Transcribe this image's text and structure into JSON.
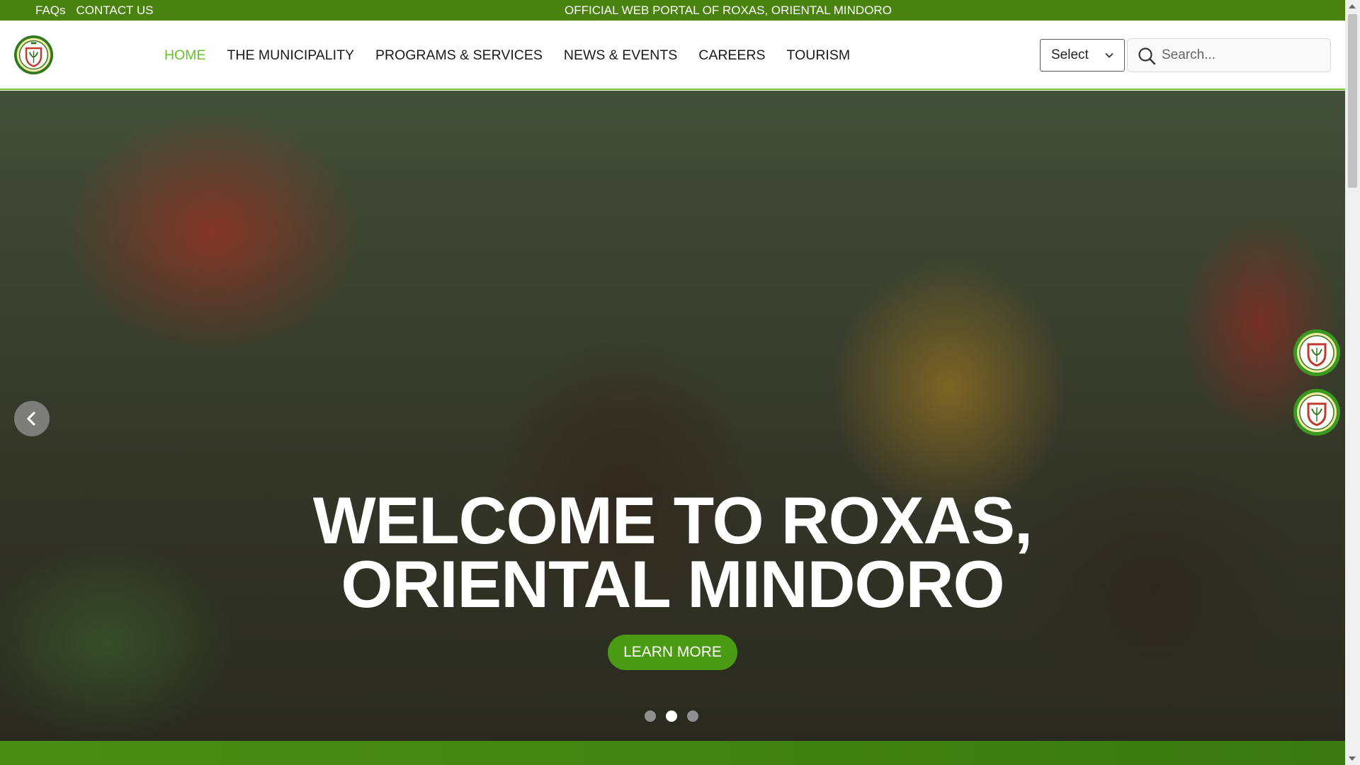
{
  "topbar": {
    "links": [
      "FAQs",
      "CONTACT US"
    ],
    "portal_title": "OFFICIAL WEB PORTAL OF ROXAS, ORIENTAL MINDORO"
  },
  "header": {
    "logo_icon": "municipal-seal-icon",
    "nav": [
      {
        "label": "HOME",
        "active": true
      },
      {
        "label": "THE MUNICIPALITY",
        "active": false
      },
      {
        "label": "PROGRAMS & SERVICES",
        "active": false
      },
      {
        "label": "NEWS & EVENTS",
        "active": false
      },
      {
        "label": "CAREERS",
        "active": false
      },
      {
        "label": "TOURISM",
        "active": false
      }
    ],
    "language_select": {
      "selected": "Select"
    },
    "search": {
      "placeholder": "Search...",
      "value": ""
    }
  },
  "hero": {
    "title_line1": "WELCOME TO ROXAS,",
    "title_line2": "ORIENTAL MINDORO",
    "cta_label": "LEARN MORE",
    "slides_total": 3,
    "active_slide": 2
  },
  "colors": {
    "topbar": "#4a8210",
    "nav_active": "#6bbf2a",
    "cta": "#4a9a14",
    "accent_border": "#7cbf2e"
  }
}
